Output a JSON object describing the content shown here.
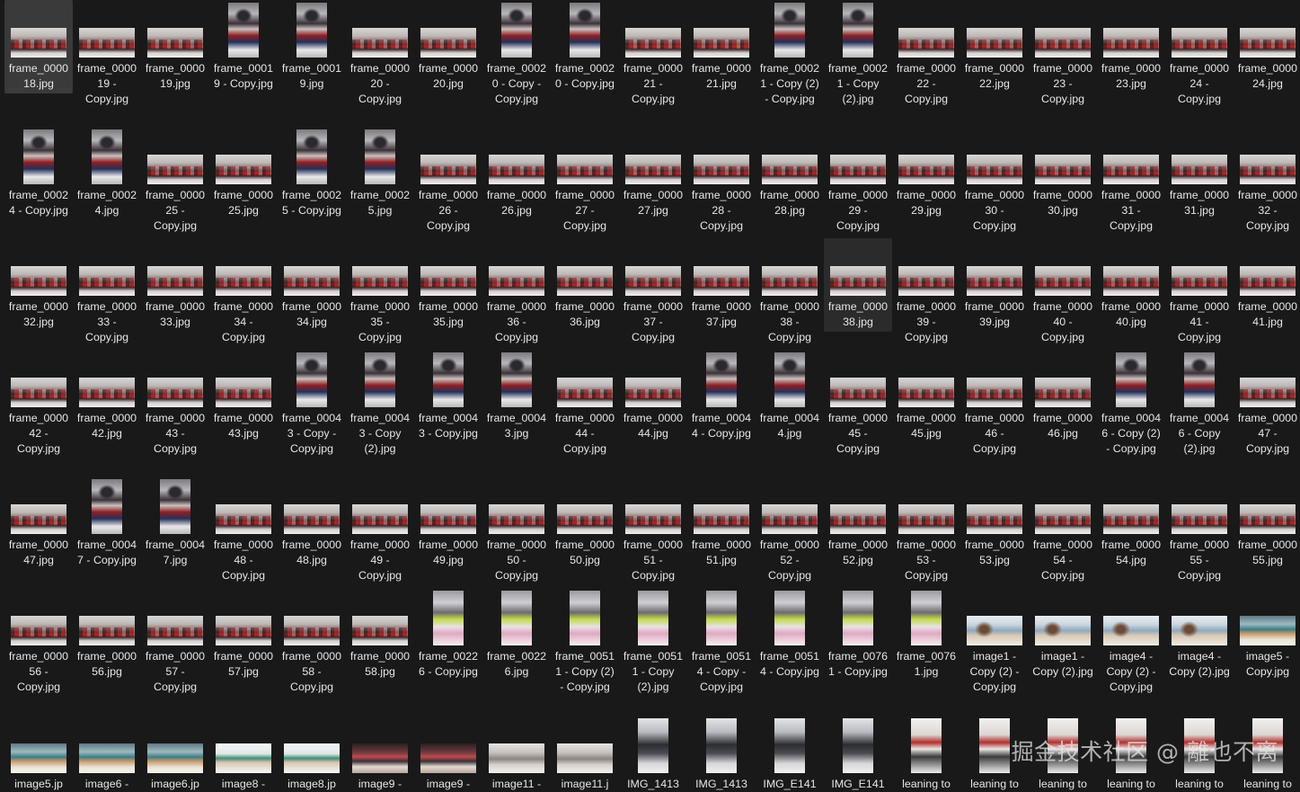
{
  "grid": {
    "rows": [
      [
        {
          "name": "frame_000018.jpg",
          "thumb": "class",
          "selected": true
        },
        {
          "name": "frame_000019 - Copy.jpg",
          "thumb": "class"
        },
        {
          "name": "frame_000019.jpg",
          "thumb": "class"
        },
        {
          "name": "frame_00019 - Copy.jpg",
          "thumb": "desk"
        },
        {
          "name": "frame_00019.jpg",
          "thumb": "desk"
        },
        {
          "name": "frame_000020 - Copy.jpg",
          "thumb": "class"
        },
        {
          "name": "frame_000020.jpg",
          "thumb": "class"
        },
        {
          "name": "frame_00020 - Copy - Copy.jpg",
          "thumb": "desk"
        },
        {
          "name": "frame_00020 - Copy.jpg",
          "thumb": "desk"
        },
        {
          "name": "frame_000021 - Copy.jpg",
          "thumb": "class"
        },
        {
          "name": "frame_000021.jpg",
          "thumb": "class"
        },
        {
          "name": "frame_00021 - Copy (2) - Copy.jpg",
          "thumb": "desk"
        },
        {
          "name": "frame_00021 - Copy (2).jpg",
          "thumb": "desk"
        },
        {
          "name": "frame_000022 - Copy.jpg",
          "thumb": "class"
        },
        {
          "name": "frame_000022.jpg",
          "thumb": "class"
        },
        {
          "name": "frame_000023 - Copy.jpg",
          "thumb": "class"
        },
        {
          "name": "frame_000023.jpg",
          "thumb": "class"
        },
        {
          "name": "frame_000024 - Copy.jpg",
          "thumb": "class"
        },
        {
          "name": "frame_000024.jpg",
          "thumb": "class"
        }
      ],
      [
        {
          "name": "frame_00024 - Copy.jpg",
          "thumb": "desk"
        },
        {
          "name": "frame_00024.jpg",
          "thumb": "desk"
        },
        {
          "name": "frame_000025 - Copy.jpg",
          "thumb": "class"
        },
        {
          "name": "frame_000025.jpg",
          "thumb": "class"
        },
        {
          "name": "frame_00025 - Copy.jpg",
          "thumb": "desk"
        },
        {
          "name": "frame_00025.jpg",
          "thumb": "desk"
        },
        {
          "name": "frame_000026 - Copy.jpg",
          "thumb": "class"
        },
        {
          "name": "frame_000026.jpg",
          "thumb": "class"
        },
        {
          "name": "frame_000027 - Copy.jpg",
          "thumb": "class"
        },
        {
          "name": "frame_000027.jpg",
          "thumb": "class"
        },
        {
          "name": "frame_000028 - Copy.jpg",
          "thumb": "class"
        },
        {
          "name": "frame_000028.jpg",
          "thumb": "class"
        },
        {
          "name": "frame_000029 - Copy.jpg",
          "thumb": "class"
        },
        {
          "name": "frame_000029.jpg",
          "thumb": "class"
        },
        {
          "name": "frame_000030 - Copy.jpg",
          "thumb": "class"
        },
        {
          "name": "frame_000030.jpg",
          "thumb": "class"
        },
        {
          "name": "frame_000031 - Copy.jpg",
          "thumb": "class"
        },
        {
          "name": "frame_000031.jpg",
          "thumb": "class"
        },
        {
          "name": "frame_000032 - Copy.jpg",
          "thumb": "class"
        }
      ],
      [
        {
          "name": "frame_000032.jpg",
          "thumb": "class"
        },
        {
          "name": "frame_000033 - Copy.jpg",
          "thumb": "class"
        },
        {
          "name": "frame_000033.jpg",
          "thumb": "class"
        },
        {
          "name": "frame_000034 - Copy.jpg",
          "thumb": "class"
        },
        {
          "name": "frame_000034.jpg",
          "thumb": "class"
        },
        {
          "name": "frame_000035 - Copy.jpg",
          "thumb": "class"
        },
        {
          "name": "frame_000035.jpg",
          "thumb": "class"
        },
        {
          "name": "frame_000036 - Copy.jpg",
          "thumb": "class"
        },
        {
          "name": "frame_000036.jpg",
          "thumb": "class"
        },
        {
          "name": "frame_000037 - Copy.jpg",
          "thumb": "class"
        },
        {
          "name": "frame_000037.jpg",
          "thumb": "class"
        },
        {
          "name": "frame_000038 - Copy.jpg",
          "thumb": "class"
        },
        {
          "name": "frame_000038.jpg",
          "thumb": "class",
          "hover": true
        },
        {
          "name": "frame_000039 - Copy.jpg",
          "thumb": "class"
        },
        {
          "name": "frame_000039.jpg",
          "thumb": "class"
        },
        {
          "name": "frame_000040 - Copy.jpg",
          "thumb": "class"
        },
        {
          "name": "frame_000040.jpg",
          "thumb": "class"
        },
        {
          "name": "frame_000041 - Copy.jpg",
          "thumb": "class"
        },
        {
          "name": "frame_000041.jpg",
          "thumb": "class"
        }
      ],
      [
        {
          "name": "frame_000042 - Copy.jpg",
          "thumb": "class"
        },
        {
          "name": "frame_000042.jpg",
          "thumb": "class"
        },
        {
          "name": "frame_000043 - Copy.jpg",
          "thumb": "class"
        },
        {
          "name": "frame_000043.jpg",
          "thumb": "class"
        },
        {
          "name": "frame_00043 - Copy - Copy.jpg",
          "thumb": "desk"
        },
        {
          "name": "frame_00043 - Copy (2).jpg",
          "thumb": "desk"
        },
        {
          "name": "frame_00043 - Copy.jpg",
          "thumb": "desk"
        },
        {
          "name": "frame_00043.jpg",
          "thumb": "desk"
        },
        {
          "name": "frame_000044 - Copy.jpg",
          "thumb": "class"
        },
        {
          "name": "frame_000044.jpg",
          "thumb": "class"
        },
        {
          "name": "frame_00044 - Copy.jpg",
          "thumb": "desk"
        },
        {
          "name": "frame_00044.jpg",
          "thumb": "desk"
        },
        {
          "name": "frame_000045 - Copy.jpg",
          "thumb": "class"
        },
        {
          "name": "frame_000045.jpg",
          "thumb": "class"
        },
        {
          "name": "frame_000046 - Copy.jpg",
          "thumb": "class"
        },
        {
          "name": "frame_000046.jpg",
          "thumb": "class"
        },
        {
          "name": "frame_00046 - Copy (2) - Copy.jpg",
          "thumb": "desk"
        },
        {
          "name": "frame_00046 - Copy (2).jpg",
          "thumb": "desk"
        },
        {
          "name": "frame_000047 - Copy.jpg",
          "thumb": "class"
        }
      ],
      [
        {
          "name": "frame_000047.jpg",
          "thumb": "class"
        },
        {
          "name": "frame_00047 - Copy.jpg",
          "thumb": "desk"
        },
        {
          "name": "frame_00047.jpg",
          "thumb": "desk"
        },
        {
          "name": "frame_000048 - Copy.jpg",
          "thumb": "class"
        },
        {
          "name": "frame_000048.jpg",
          "thumb": "class"
        },
        {
          "name": "frame_000049 - Copy.jpg",
          "thumb": "class"
        },
        {
          "name": "frame_000049.jpg",
          "thumb": "class"
        },
        {
          "name": "frame_000050 - Copy.jpg",
          "thumb": "class"
        },
        {
          "name": "frame_000050.jpg",
          "thumb": "class"
        },
        {
          "name": "frame_000051 - Copy.jpg",
          "thumb": "class"
        },
        {
          "name": "frame_000051.jpg",
          "thumb": "class"
        },
        {
          "name": "frame_000052 - Copy.jpg",
          "thumb": "class"
        },
        {
          "name": "frame_000052.jpg",
          "thumb": "class"
        },
        {
          "name": "frame_000053 - Copy.jpg",
          "thumb": "class"
        },
        {
          "name": "frame_000053.jpg",
          "thumb": "class"
        },
        {
          "name": "frame_000054 - Copy.jpg",
          "thumb": "class"
        },
        {
          "name": "frame_000054.jpg",
          "thumb": "class"
        },
        {
          "name": "frame_000055 - Copy.jpg",
          "thumb": "class"
        },
        {
          "name": "frame_000055.jpg",
          "thumb": "class"
        }
      ],
      [
        {
          "name": "frame_000056 - Copy.jpg",
          "thumb": "class"
        },
        {
          "name": "frame_000056.jpg",
          "thumb": "class"
        },
        {
          "name": "frame_000057 - Copy.jpg",
          "thumb": "class"
        },
        {
          "name": "frame_000057.jpg",
          "thumb": "class"
        },
        {
          "name": "frame_000058 - Copy.jpg",
          "thumb": "class"
        },
        {
          "name": "frame_000058.jpg",
          "thumb": "class"
        },
        {
          "name": "frame_00226 - Copy.jpg",
          "thumb": "kid"
        },
        {
          "name": "frame_00226.jpg",
          "thumb": "kid"
        },
        {
          "name": "frame_00511 - Copy (2) - Copy.jpg",
          "thumb": "kid"
        },
        {
          "name": "frame_00511 - Copy (2).jpg",
          "thumb": "kid"
        },
        {
          "name": "frame_00514 - Copy - Copy.jpg",
          "thumb": "kid"
        },
        {
          "name": "frame_00514 - Copy.jpg",
          "thumb": "kid"
        },
        {
          "name": "frame_00761 - Copy.jpg",
          "thumb": "kid"
        },
        {
          "name": "frame_00761.jpg",
          "thumb": "kid"
        },
        {
          "name": "image1 - Copy (2) - Copy.jpg",
          "thumb": "study"
        },
        {
          "name": "image1 - Copy (2).jpg",
          "thumb": "study"
        },
        {
          "name": "image4 - Copy (2) - Copy.jpg",
          "thumb": "study"
        },
        {
          "name": "image4 - Copy (2).jpg",
          "thumb": "study"
        },
        {
          "name": "image5 - Copy.jpg",
          "thumb": "teal"
        }
      ],
      [
        {
          "name": "image5.jp",
          "thumb": "teal"
        },
        {
          "name": "image6 -",
          "thumb": "teal"
        },
        {
          "name": "image6.jp",
          "thumb": "teal"
        },
        {
          "name": "image8 -",
          "thumb": "office"
        },
        {
          "name": "image8.jp",
          "thumb": "office"
        },
        {
          "name": "image9 -",
          "thumb": "group"
        },
        {
          "name": "image9 -",
          "thumb": "group"
        },
        {
          "name": "image11 -",
          "thumb": "grey"
        },
        {
          "name": "image11.j",
          "thumb": "grey"
        },
        {
          "name": "IMG_1413",
          "thumb": "dark"
        },
        {
          "name": "IMG_1413",
          "thumb": "dark"
        },
        {
          "name": "IMG_E141",
          "thumb": "dark"
        },
        {
          "name": "IMG_E141",
          "thumb": "dark"
        },
        {
          "name": "leaning to",
          "thumb": "lean"
        },
        {
          "name": "leaning to",
          "thumb": "lean"
        },
        {
          "name": "leaning to",
          "thumb": "lean"
        },
        {
          "name": "leaning to",
          "thumb": "lean"
        },
        {
          "name": "leaning to",
          "thumb": "lean"
        },
        {
          "name": "leaning to",
          "thumb": "lean"
        }
      ]
    ]
  },
  "watermark": "掘金技术社区 @ 離也不离"
}
